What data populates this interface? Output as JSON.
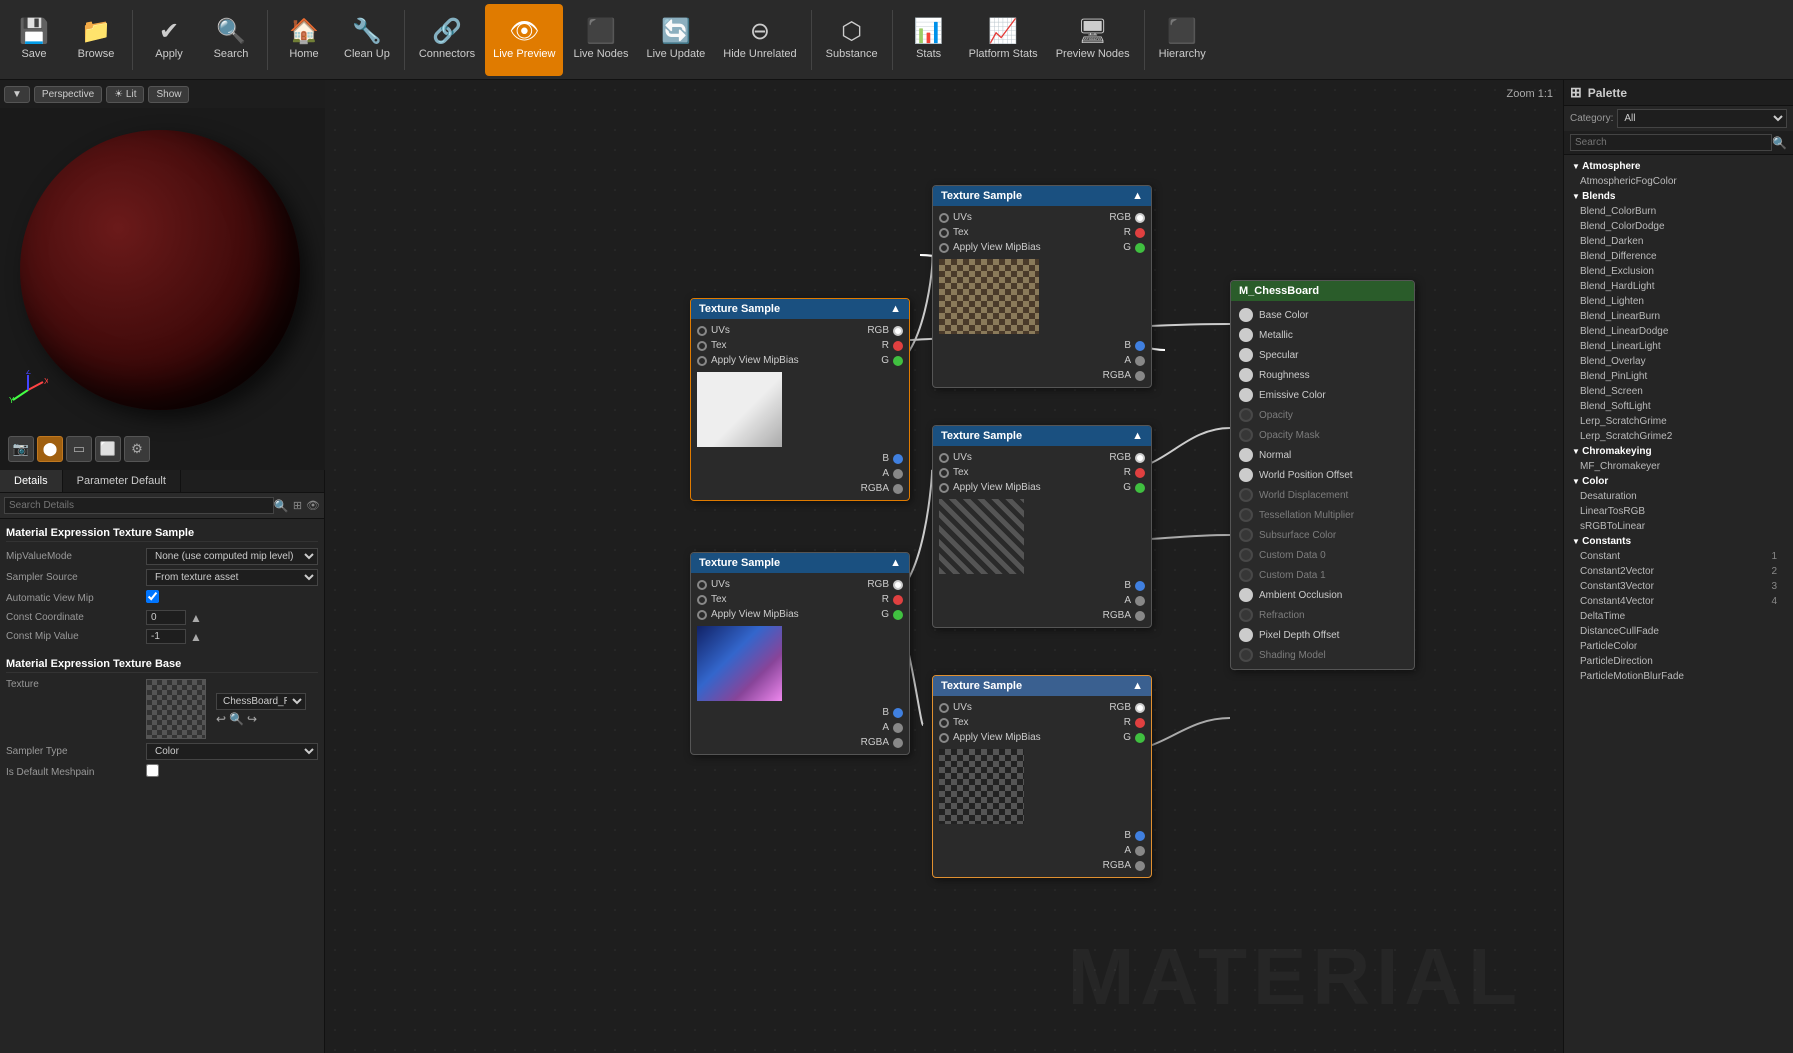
{
  "toolbar": {
    "buttons": [
      {
        "id": "save",
        "label": "Save",
        "icon": "💾",
        "active": false
      },
      {
        "id": "browse",
        "label": "Browse",
        "icon": "📁",
        "active": false
      },
      {
        "id": "apply",
        "label": "Apply",
        "icon": "✔",
        "active": false
      },
      {
        "id": "search",
        "label": "Search",
        "icon": "🔍",
        "active": false
      },
      {
        "id": "home",
        "label": "Home",
        "icon": "🏠",
        "active": false
      },
      {
        "id": "cleanup",
        "label": "Clean Up",
        "icon": "🔧",
        "active": false
      },
      {
        "id": "connectors",
        "label": "Connectors",
        "icon": "🔗",
        "active": false
      },
      {
        "id": "livepreview",
        "label": "Live Preview",
        "icon": "👁",
        "active": true
      },
      {
        "id": "livenodes",
        "label": "Live Nodes",
        "icon": "⬛",
        "active": false
      },
      {
        "id": "liveupdate",
        "label": "Live Update",
        "icon": "🔄",
        "active": false
      },
      {
        "id": "hideunrelated",
        "label": "Hide Unrelated",
        "icon": "⊖",
        "active": false
      },
      {
        "id": "substance",
        "label": "Substance",
        "icon": "⬡",
        "active": false
      },
      {
        "id": "stats",
        "label": "Stats",
        "icon": "📊",
        "active": false
      },
      {
        "id": "platformstats",
        "label": "Platform Stats",
        "icon": "📈",
        "active": false
      },
      {
        "id": "previewnodes",
        "label": "Preview Nodes",
        "icon": "🖥",
        "active": false
      },
      {
        "id": "hierarchy",
        "label": "Hierarchy",
        "icon": "⬛",
        "active": false
      }
    ]
  },
  "viewport": {
    "mode": "Perspective",
    "lighting": "Lit",
    "show": "Show",
    "zoom": "Zoom 1:1"
  },
  "details": {
    "tab1": "Details",
    "tab2": "Parameter Default",
    "search_placeholder": "Search Details",
    "mat_expr_title": "Material Expression Texture Sample",
    "mip_label": "MipValueMode",
    "mip_value": "None (use computed mip level)",
    "sampler_label": "Sampler Source",
    "sampler_value": "From texture asset",
    "automip_label": "Automatic View Mip",
    "automip_checked": true,
    "constcoord_label": "Const Coordinate",
    "constcoord_value": "0",
    "constmip_label": "Const Mip Value",
    "constmip_value": "-1",
    "mat_base_title": "Material Expression Texture Base",
    "texture_label": "Texture",
    "texture_value": "ChessBoard_Rough",
    "sampler_type_label": "Sampler Type",
    "sampler_type_value": "Color",
    "default_mesh_label": "Is Default Meshpain"
  },
  "nodes": {
    "texture_sample_1": {
      "title": "Texture Sample",
      "thumb_class": "thumb-checker",
      "inputs": [
        "UVs",
        "Tex",
        "Apply View MipBias"
      ],
      "outputs": [
        "RGB",
        "R",
        "G",
        "B",
        "A",
        "RGBA"
      ]
    },
    "texture_sample_2": {
      "title": "Texture Sample",
      "thumb_class": "thumb-checker",
      "inputs": [
        "UVs",
        "Tex",
        "Apply View MipBias"
      ],
      "outputs": [
        "RGB",
        "R",
        "G",
        "B",
        "A",
        "RGBA"
      ]
    },
    "texture_sample_3": {
      "title": "Texture Sample",
      "thumb_class": "thumb-white",
      "inputs": [
        "UVs",
        "Tex",
        "Apply View MipBias"
      ],
      "outputs": [
        "RGB",
        "R",
        "G",
        "B",
        "A",
        "RGBA"
      ]
    },
    "texture_sample_4": {
      "title": "Texture Sample",
      "thumb_class": "thumb-blue",
      "inputs": [
        "UVs",
        "Tex",
        "Apply View MipBias"
      ],
      "outputs": [
        "RGB",
        "R",
        "G",
        "B",
        "A",
        "RGBA"
      ]
    },
    "texture_sample_5": {
      "title": "Texture Sample",
      "thumb_class": "thumb-dark-checker",
      "inputs": [
        "UVs",
        "Tex",
        "Apply View MipBias"
      ],
      "outputs": [
        "RGB",
        "R",
        "G",
        "B",
        "A",
        "RGBA"
      ]
    },
    "m_chessboard": {
      "title": "M_ChessBoard",
      "inputs": [
        "Base Color",
        "Metallic",
        "Specular",
        "Roughness",
        "Emissive Color",
        "Opacity",
        "Opacity Mask",
        "Normal",
        "World Position Offset",
        "World Displacement",
        "Tessellation Multiplier",
        "Subsurface Color",
        "Custom Data 0",
        "Custom Data 1",
        "Ambient Occlusion",
        "Refraction",
        "Pixel Depth Offset",
        "Shading Model"
      ]
    }
  },
  "palette": {
    "title": "Palette",
    "category_label": "Category:",
    "category_value": "All",
    "search_placeholder": "Search",
    "categories": [
      {
        "name": "Atmosphere",
        "items": [
          {
            "label": "AtmosphericFogColor",
            "num": ""
          }
        ]
      },
      {
        "name": "Blends",
        "items": [
          {
            "label": "Blend_ColorBurn",
            "num": ""
          },
          {
            "label": "Blend_ColorDodge",
            "num": ""
          },
          {
            "label": "Blend_Darken",
            "num": ""
          },
          {
            "label": "Blend_Difference",
            "num": ""
          },
          {
            "label": "Blend_Exclusion",
            "num": ""
          },
          {
            "label": "Blend_HardLight",
            "num": ""
          },
          {
            "label": "Blend_Lighten",
            "num": ""
          },
          {
            "label": "Blend_LinearBurn",
            "num": ""
          },
          {
            "label": "Blend_LinearDodge",
            "num": ""
          },
          {
            "label": "Blend_LinearLight",
            "num": ""
          },
          {
            "label": "Blend_Overlay",
            "num": ""
          },
          {
            "label": "Blend_PinLight",
            "num": ""
          },
          {
            "label": "Blend_Screen",
            "num": ""
          },
          {
            "label": "Blend_SoftLight",
            "num": ""
          },
          {
            "label": "Lerp_ScratchGrime",
            "num": ""
          },
          {
            "label": "Lerp_ScratchGrime2",
            "num": ""
          }
        ]
      },
      {
        "name": "Chromakeying",
        "items": [
          {
            "label": "MF_Chromakeyer",
            "num": ""
          }
        ]
      },
      {
        "name": "Color",
        "items": [
          {
            "label": "Desaturation",
            "num": ""
          },
          {
            "label": "LinearTosRGB",
            "num": ""
          },
          {
            "label": "sRGBToLinear",
            "num": ""
          }
        ]
      },
      {
        "name": "Constants",
        "items": [
          {
            "label": "Constant",
            "num": "1"
          },
          {
            "label": "Constant2Vector",
            "num": "2"
          },
          {
            "label": "Constant3Vector",
            "num": "3"
          },
          {
            "label": "Constant4Vector",
            "num": "4"
          },
          {
            "label": "DeltaTime",
            "num": ""
          },
          {
            "label": "DistanceCullFade",
            "num": ""
          },
          {
            "label": "ParticleColor",
            "num": ""
          },
          {
            "label": "ParticleDirection",
            "num": ""
          },
          {
            "label": "ParticleMotionBlurFade",
            "num": ""
          }
        ]
      }
    ]
  },
  "canvas_bg_text": "MATERIAL"
}
